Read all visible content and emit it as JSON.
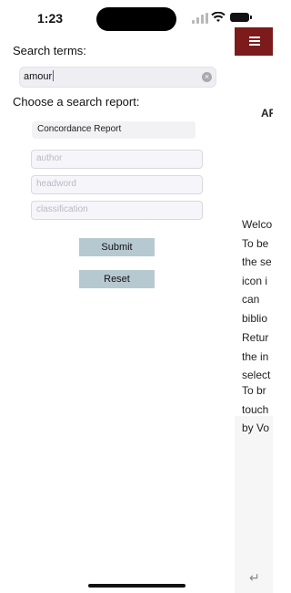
{
  "status_bar": {
    "time": "1:23"
  },
  "search_panel": {
    "search_terms_label": "Search terms:",
    "search_value": "amour",
    "choose_report_label": "Choose a search report:",
    "report_selected": "Concordance Report",
    "author_placeholder": "author",
    "headword_placeholder": "headword",
    "classification_placeholder": "classification",
    "submit_label": "Submit",
    "reset_label": "Reset"
  },
  "right_panel": {
    "title": "AR",
    "paragraphs": [
      [
        "Welco",
        "To be",
        "the se",
        "icon i",
        "can",
        "biblio"
      ],
      [
        "Retur",
        "the in",
        "select"
      ],
      [
        "To br",
        "touch",
        "by Vo"
      ]
    ]
  },
  "colors": {
    "header_bar": "#7c1b1b",
    "button": "#b7c9d0"
  }
}
